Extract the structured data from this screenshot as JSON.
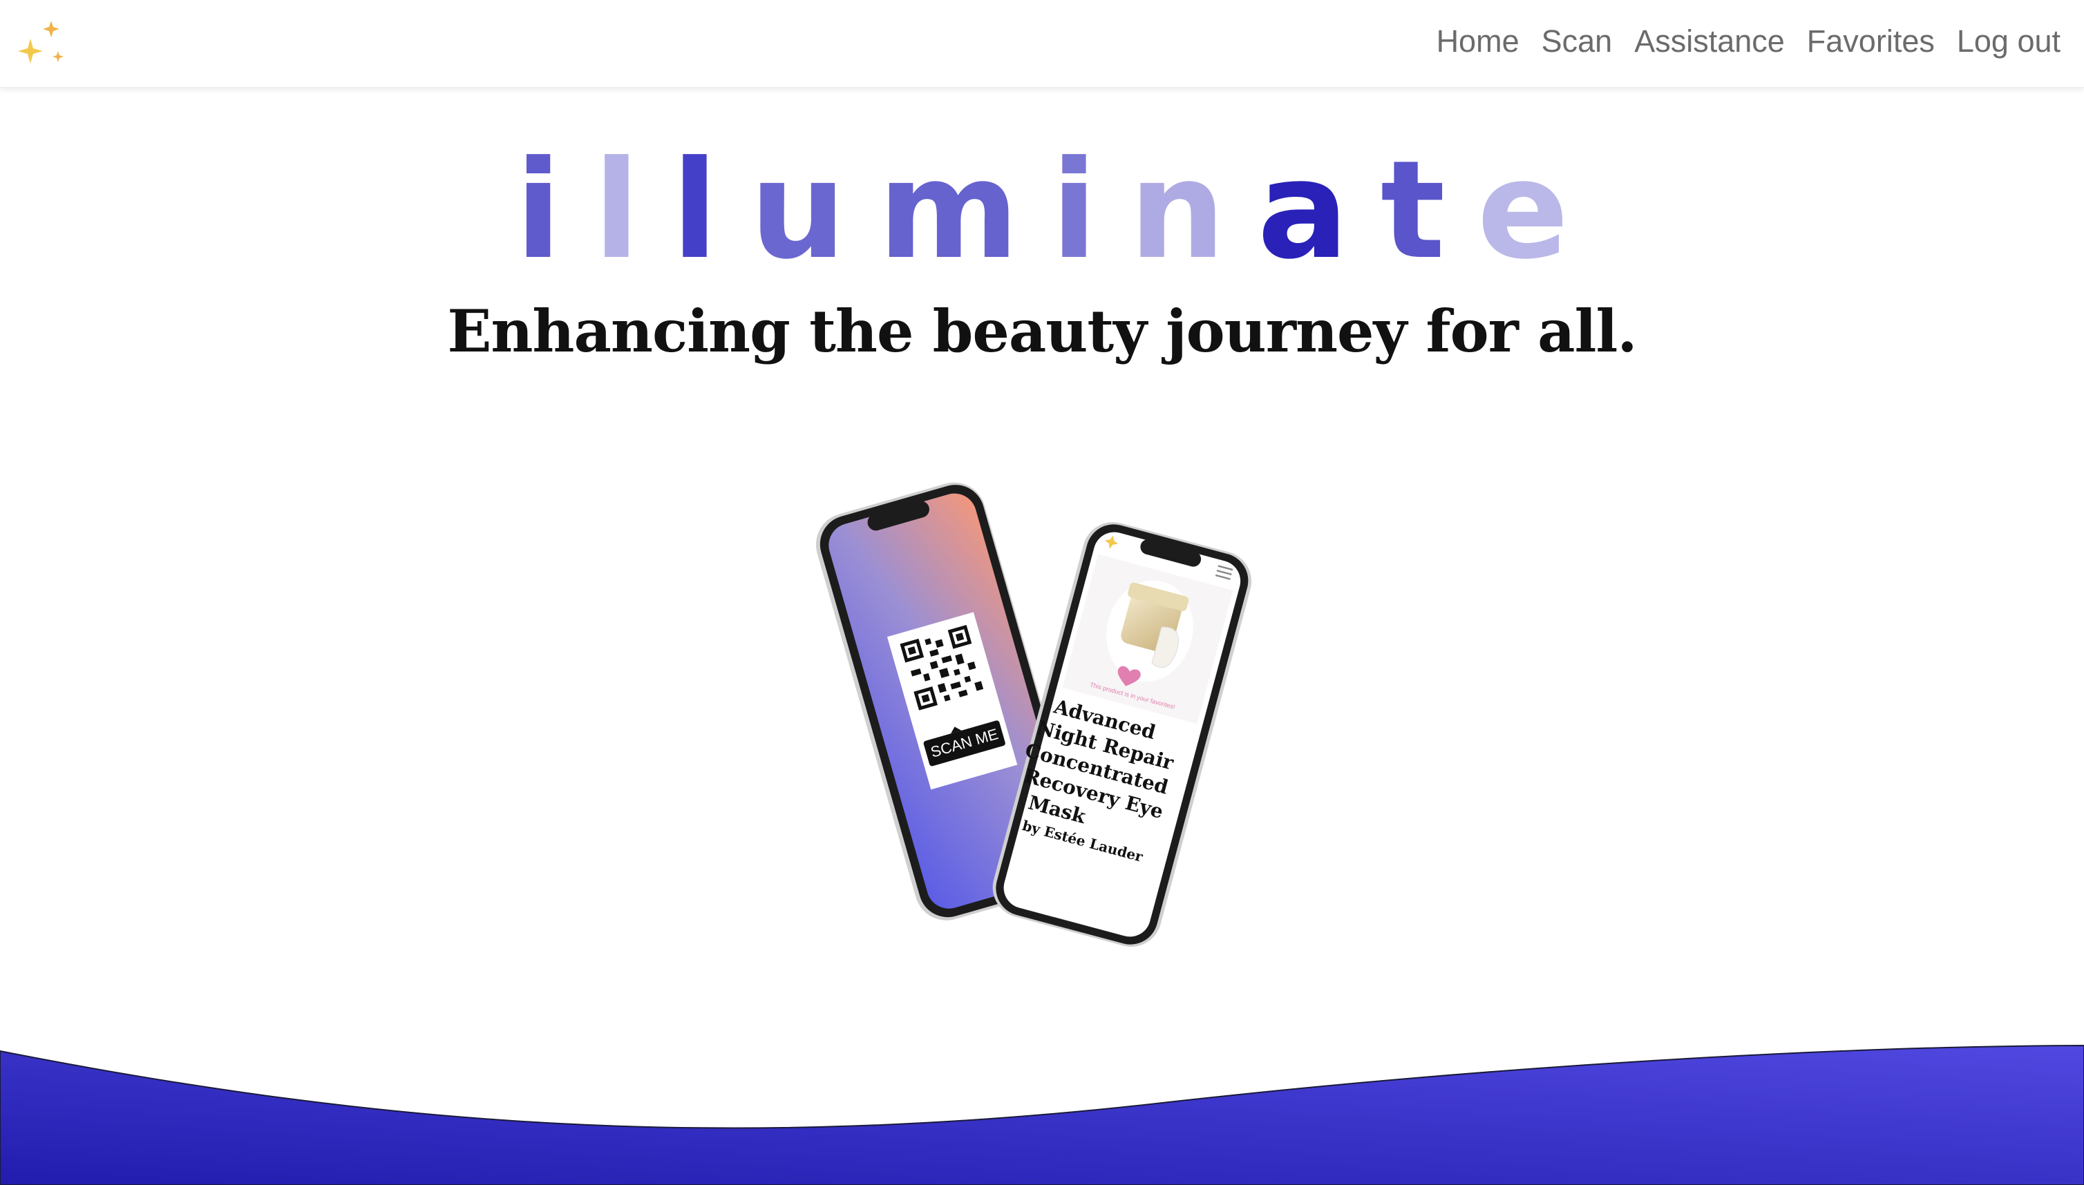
{
  "navbar": {
    "logo_icon": "sparkles-icon",
    "links": [
      "Home",
      "Scan",
      "Assistance",
      "Favorites",
      "Log out"
    ]
  },
  "hero": {
    "title_letters": [
      "i",
      "l",
      "l",
      "u",
      "m",
      "i",
      "n",
      "a",
      "t",
      "e"
    ],
    "title_letter_colors": [
      "#5f5bcc",
      "#b4b2e6",
      "#4540c8",
      "#6b67d0",
      "#6663cf",
      "#7a76d4",
      "#aeabe4",
      "#2921b8",
      "#5a55ca",
      "#bab8e8"
    ],
    "tagline": "Enhancing the beauty journey for all."
  },
  "illustration": {
    "scan_badge": "SCAN ME",
    "favorite_note": "This product is in your favorites!",
    "product_name_lines": [
      "Advanced",
      "Night Repair",
      "Concentrated",
      "Recovery Eye",
      "Mask"
    ],
    "product_brand": "by Estée Lauder"
  },
  "colors": {
    "accent": "#3b36c9",
    "wave_start": "#221cae",
    "wave_end": "#5048e0",
    "nav_text": "#6b6b6b"
  }
}
